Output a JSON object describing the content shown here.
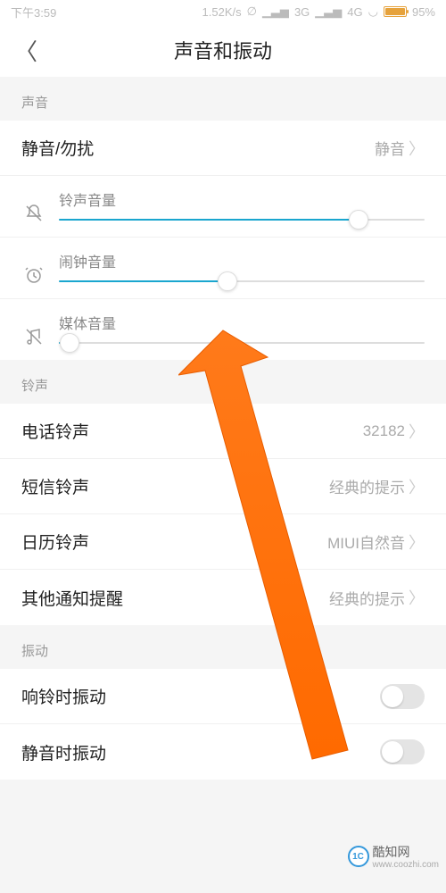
{
  "status": {
    "time": "下午3:59",
    "speed": "1.52K/s",
    "net1": "3G",
    "net2": "4G",
    "battery": "95%"
  },
  "header": {
    "title": "声音和振动"
  },
  "section_sound": {
    "label": "声音"
  },
  "silent_row": {
    "label": "静音/勿扰",
    "value": "静音"
  },
  "sliders": {
    "ring": {
      "label": "铃声音量",
      "percent": 82
    },
    "alarm": {
      "label": "闹钟音量",
      "percent": 46
    },
    "media": {
      "label": "媒体音量",
      "percent": 3
    }
  },
  "section_ringtone": {
    "label": "铃声"
  },
  "ringtones": {
    "phone": {
      "label": "电话铃声",
      "value": "32182"
    },
    "sms": {
      "label": "短信铃声",
      "value": "经典的提示"
    },
    "calendar": {
      "label": "日历铃声",
      "value": "MIUI自然音"
    },
    "other": {
      "label": "其他通知提醒",
      "value": "经典的提示"
    }
  },
  "section_vibrate": {
    "label": "振动"
  },
  "vibrate": {
    "ring": {
      "label": "响铃时振动"
    },
    "silent": {
      "label": "静音时振动"
    }
  },
  "watermark": {
    "brand": "酷知网",
    "url": "www.coozhi.com"
  }
}
